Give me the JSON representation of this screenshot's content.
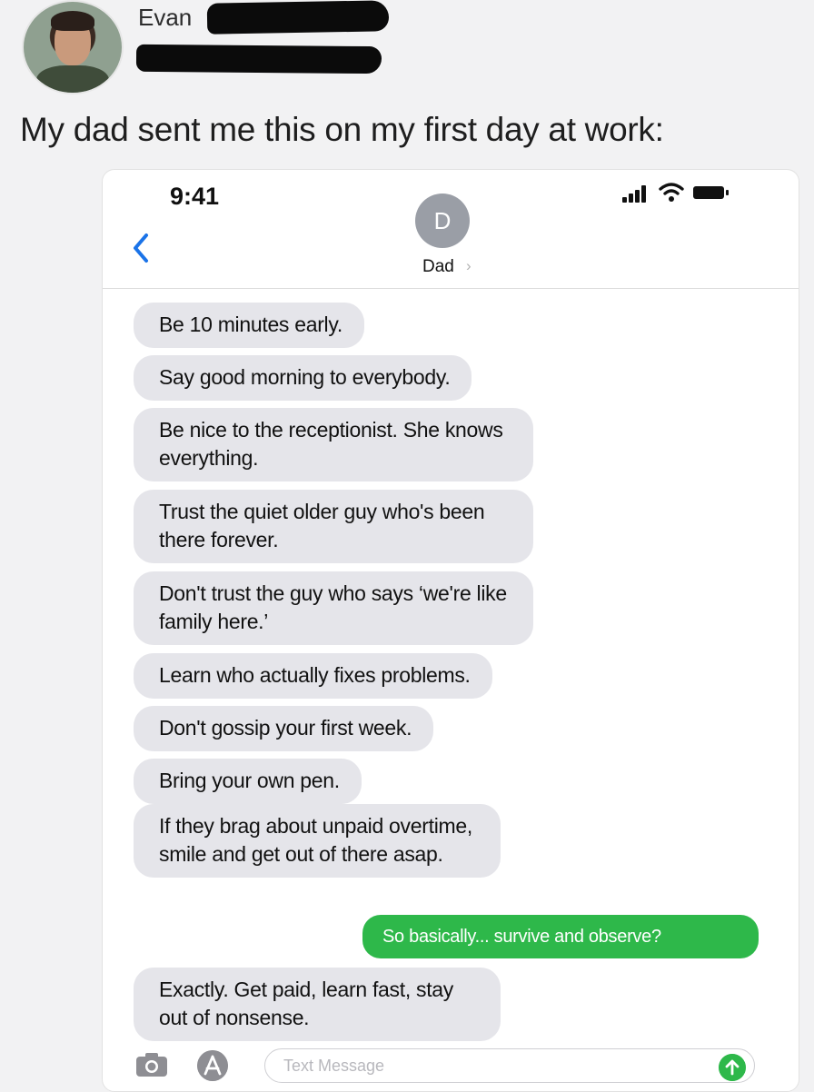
{
  "post": {
    "author_name": "Evan",
    "caption": "My dad sent me this on my first day at work:"
  },
  "phone": {
    "status_time": "9:41",
    "contact_initial": "D",
    "contact_name": "Dad",
    "contact_chevron": "›",
    "compose_placeholder": "Text Message",
    "icons": [
      "back-chevron-icon",
      "signal-icon",
      "wifi-icon",
      "battery-icon",
      "camera-icon",
      "app-store-icon",
      "send-arrow-icon"
    ],
    "colors": {
      "outgoing_bubble": "#2eb84a",
      "incoming_bubble": "#e5e5ea",
      "ios_blue": "#1a73e8"
    }
  },
  "messages": [
    {
      "from": "Dad",
      "text": "Be 10 minutes early."
    },
    {
      "from": "Dad",
      "text": "Say good morning to everybody."
    },
    {
      "from": "Dad",
      "text": "Be nice to the receptionist. She knows everything."
    },
    {
      "from": "Dad",
      "text": "Trust the quiet older guy who's been there forever."
    },
    {
      "from": "Dad",
      "text": "Don't trust the guy who says ‘we're like family here.’"
    },
    {
      "from": "Dad",
      "text": "Learn who actually fixes problems."
    },
    {
      "from": "Dad",
      "text": "Don't gossip your first week."
    },
    {
      "from": "Dad",
      "text": "Bring your own pen."
    },
    {
      "from": "Dad",
      "text": "If they brag about unpaid overtime, smile and get out of there asap."
    },
    {
      "from": "me",
      "text": "So basically... survive and observe?"
    },
    {
      "from": "Dad",
      "text": "Exactly. Get paid, learn fast, stay out of nonsense."
    }
  ]
}
